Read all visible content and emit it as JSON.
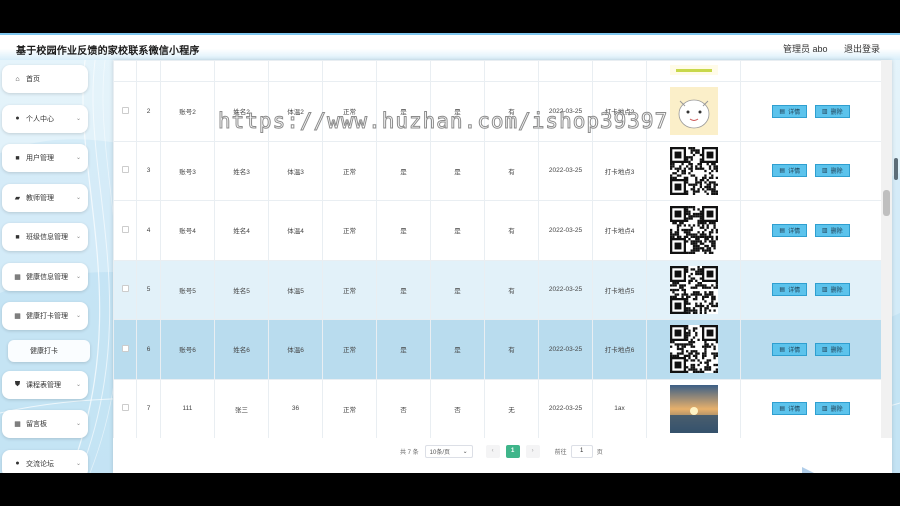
{
  "header": {
    "title": "基于校园作业反馈的家校联系微信小程序",
    "user_label": "管理员 abo",
    "logout_label": "退出登录"
  },
  "sidebar": {
    "items": [
      {
        "label": "首页",
        "icon": "home-icon",
        "expandable": false
      },
      {
        "label": "个人中心",
        "icon": "user-icon",
        "expandable": true
      },
      {
        "label": "用户管理",
        "icon": "folder-icon",
        "expandable": true
      },
      {
        "label": "教师管理",
        "icon": "briefcase-icon",
        "expandable": true
      },
      {
        "label": "班级信息管理",
        "icon": "folder-icon",
        "expandable": true
      },
      {
        "label": "健康信息管理",
        "icon": "grid-icon",
        "expandable": true
      },
      {
        "label": "健康打卡管理",
        "icon": "grid-icon",
        "expandable": true
      },
      {
        "label": "健康打卡",
        "icon": "",
        "expandable": false,
        "sub": true
      },
      {
        "label": "课程表管理",
        "icon": "shield-icon",
        "expandable": true
      },
      {
        "label": "留言板",
        "icon": "grid-icon",
        "expandable": true
      },
      {
        "label": "交流论坛",
        "icon": "user-icon",
        "expandable": true
      }
    ]
  },
  "table": {
    "rows": [
      {
        "index": "2",
        "account": "账号2",
        "name": "姓名2",
        "temp": "体温2",
        "status": "正常",
        "q1": "是",
        "q2": "是",
        "q3": "有",
        "date": "2022-03-25",
        "location": "打卡地点2",
        "image": "cartoon",
        "state": "normal"
      },
      {
        "index": "3",
        "account": "账号3",
        "name": "姓名3",
        "temp": "体温3",
        "status": "正常",
        "q1": "是",
        "q2": "是",
        "q3": "有",
        "date": "2022-03-25",
        "location": "打卡地点3",
        "image": "qr",
        "state": "normal"
      },
      {
        "index": "4",
        "account": "账号4",
        "name": "姓名4",
        "temp": "体温4",
        "status": "正常",
        "q1": "是",
        "q2": "是",
        "q3": "有",
        "date": "2022-03-25",
        "location": "打卡地点4",
        "image": "qr",
        "state": "normal"
      },
      {
        "index": "5",
        "account": "账号5",
        "name": "姓名5",
        "temp": "体温5",
        "status": "正常",
        "q1": "是",
        "q2": "是",
        "q3": "有",
        "date": "2022-03-25",
        "location": "打卡地点5",
        "image": "qr",
        "state": "hover"
      },
      {
        "index": "6",
        "account": "账号6",
        "name": "姓名6",
        "temp": "体温6",
        "status": "正常",
        "q1": "是",
        "q2": "是",
        "q3": "有",
        "date": "2022-03-25",
        "location": "打卡地点6",
        "image": "qr",
        "state": "selected"
      },
      {
        "index": "7",
        "account": "111",
        "name": "张三",
        "temp": "36",
        "status": "正常",
        "q1": "否",
        "q2": "否",
        "q3": "无",
        "date": "2022-03-25",
        "location": "1ax",
        "image": "sunset",
        "state": "normal"
      }
    ],
    "detail_label": "详情",
    "delete_label": "删除"
  },
  "pagination": {
    "total_label": "共 7 条",
    "page_size": "10条/页",
    "current_page": "1",
    "goto_label": "前往",
    "goto_value": "1",
    "page_unit": "页"
  },
  "watermark": "https://www.huzhan.com/ishop39397",
  "colors": {
    "accent": "#5cc3ec",
    "active_page": "#3fb58a",
    "selected_row": "#b9dcee",
    "hover_row": "#e2f1f9"
  }
}
